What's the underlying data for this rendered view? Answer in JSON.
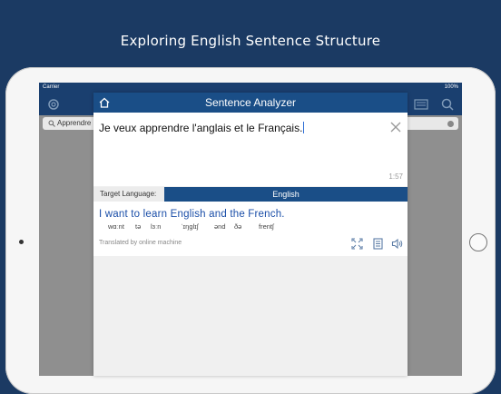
{
  "headline": "Exploring English Sentence Structure",
  "status_bar": {
    "carrier": "Carrier",
    "time": "",
    "battery": "100%"
  },
  "background_search": {
    "text": "Apprendre"
  },
  "modal": {
    "title": "Sentence Analyzer",
    "input_text": "Je veux apprendre l'anglais et le Français.",
    "char_count": "1:57",
    "target_language_label": "Target Language:",
    "target_language_value": "English",
    "result_text": "I want to learn English and the French.",
    "phonetics": [
      "wɑːnt",
      "tə",
      "lɜːn",
      "ˈɪŋglɪʃ",
      "ənd",
      "ðə",
      "frentʃ"
    ],
    "translated_by": "Translated by online machine"
  },
  "colors": {
    "navy": "#1b3a63",
    "header_blue": "#1a4e87",
    "result_blue": "#1a4ea8"
  }
}
